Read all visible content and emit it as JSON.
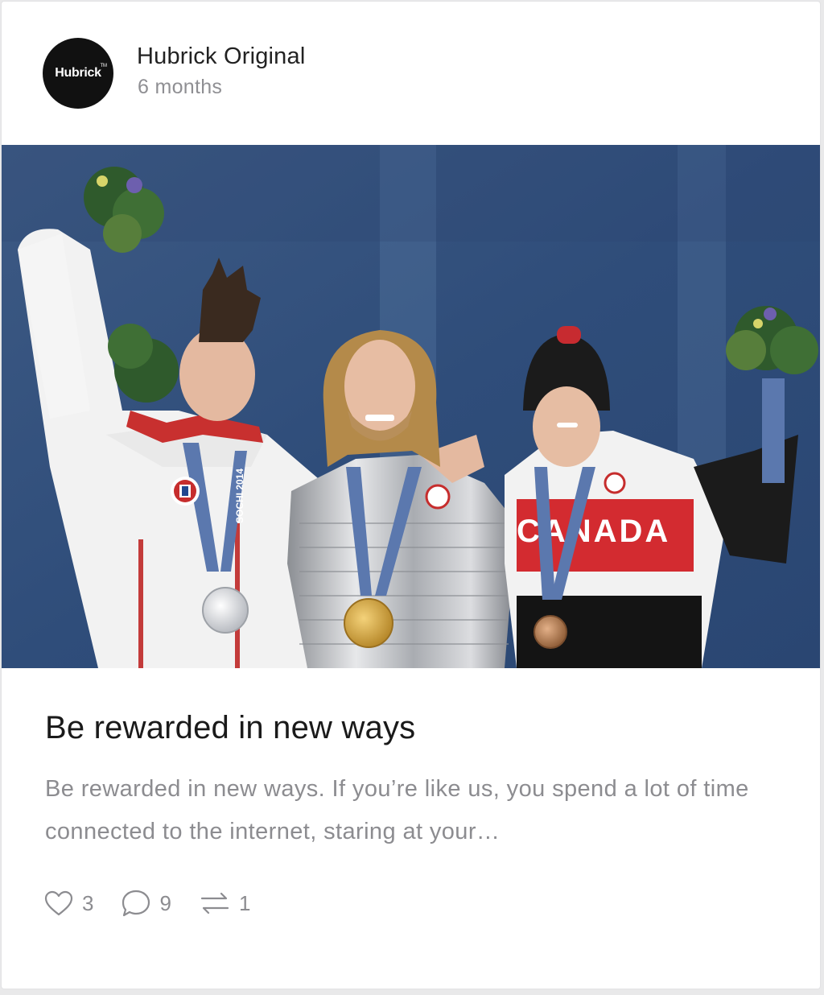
{
  "author": {
    "avatar_text": "Hubrick",
    "avatar_mark": "TM",
    "name": "Hubrick Original",
    "time": "6 months"
  },
  "post": {
    "title": "Be rewarded in new ways",
    "excerpt": "Be rewarded in new ways. If you’re like us, you spend a lot of time connected to the internet, staring at your…",
    "photo_text": {
      "ribbon": "SOCHI 2014",
      "jacket": "CANADA"
    }
  },
  "actions": {
    "likes": "3",
    "comments": "9",
    "shares": "1"
  },
  "colors": {
    "accent_text": "#222222",
    "muted_text": "#8c8c90",
    "avatar_bg": "#111111"
  }
}
